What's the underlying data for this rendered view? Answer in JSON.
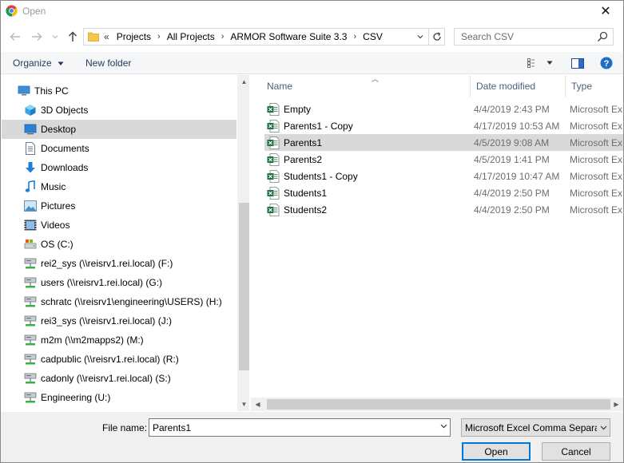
{
  "window": {
    "title": "Open",
    "close_glyph": "✕"
  },
  "address_bar": {
    "lead": "«",
    "crumbs": [
      "Projects",
      "All Projects",
      "ARMOR Software Suite 3.3",
      "CSV"
    ],
    "separator": "›"
  },
  "search": {
    "placeholder": "Search CSV"
  },
  "toolbar": {
    "organize": "Organize",
    "new_folder": "New folder"
  },
  "nav_pane": {
    "items": [
      {
        "label": "This PC",
        "icon": "pc-icon"
      },
      {
        "label": "3D Objects",
        "icon": "cube-icon"
      },
      {
        "label": "Desktop",
        "icon": "desktop-icon",
        "selected": true
      },
      {
        "label": "Documents",
        "icon": "document-icon"
      },
      {
        "label": "Downloads",
        "icon": "download-icon"
      },
      {
        "label": "Music",
        "icon": "music-icon"
      },
      {
        "label": "Pictures",
        "icon": "picture-icon"
      },
      {
        "label": "Videos",
        "icon": "video-icon"
      },
      {
        "label": "OS (C:)",
        "icon": "drive-icon"
      },
      {
        "label": "rei2_sys (\\\\reisrv1.rei.local) (F:)",
        "icon": "network-drive-icon"
      },
      {
        "label": "users (\\\\reisrv1.rei.local) (G:)",
        "icon": "network-drive-icon"
      },
      {
        "label": "schratc (\\\\reisrv1\\engineering\\USERS) (H:)",
        "icon": "network-drive-icon"
      },
      {
        "label": "rei3_sys (\\\\reisrv1.rei.local) (J:)",
        "icon": "network-drive-icon"
      },
      {
        "label": "m2m (\\\\m2mapps2) (M:)",
        "icon": "network-drive-icon"
      },
      {
        "label": "cadpublic (\\\\reisrv1.rei.local) (R:)",
        "icon": "network-drive-icon"
      },
      {
        "label": "cadonly (\\\\reisrv1.rei.local) (S:)",
        "icon": "network-drive-icon"
      },
      {
        "label": "Engineering (U:)",
        "icon": "network-drive-icon"
      }
    ]
  },
  "file_list": {
    "columns": {
      "name": "Name",
      "date": "Date modified",
      "type": "Type"
    },
    "files": [
      {
        "name": "Empty",
        "date": "4/4/2019 2:43 PM",
        "type": "Microsoft Ex"
      },
      {
        "name": "Parents1 - Copy",
        "date": "4/17/2019 10:53 AM",
        "type": "Microsoft Ex"
      },
      {
        "name": "Parents1",
        "date": "4/5/2019 9:08 AM",
        "type": "Microsoft Ex",
        "selected": true
      },
      {
        "name": "Parents2",
        "date": "4/5/2019 1:41 PM",
        "type": "Microsoft Ex"
      },
      {
        "name": "Students1 - Copy",
        "date": "4/17/2019 10:47 AM",
        "type": "Microsoft Ex"
      },
      {
        "name": "Students1",
        "date": "4/4/2019 2:50 PM",
        "type": "Microsoft Ex"
      },
      {
        "name": "Students2",
        "date": "4/4/2019 2:50 PM",
        "type": "Microsoft Ex"
      }
    ]
  },
  "bottom": {
    "file_name_label": "File name:",
    "file_name_value": "Parents1",
    "file_type_value": "Microsoft Excel Comma Separa",
    "open_label": "Open",
    "cancel_label": "Cancel"
  },
  "colors": {
    "excel_green": "#1d6f42",
    "selection": "#d9d9d9",
    "folder_yellow": "#f2c74b",
    "accent": "#0078d7"
  }
}
